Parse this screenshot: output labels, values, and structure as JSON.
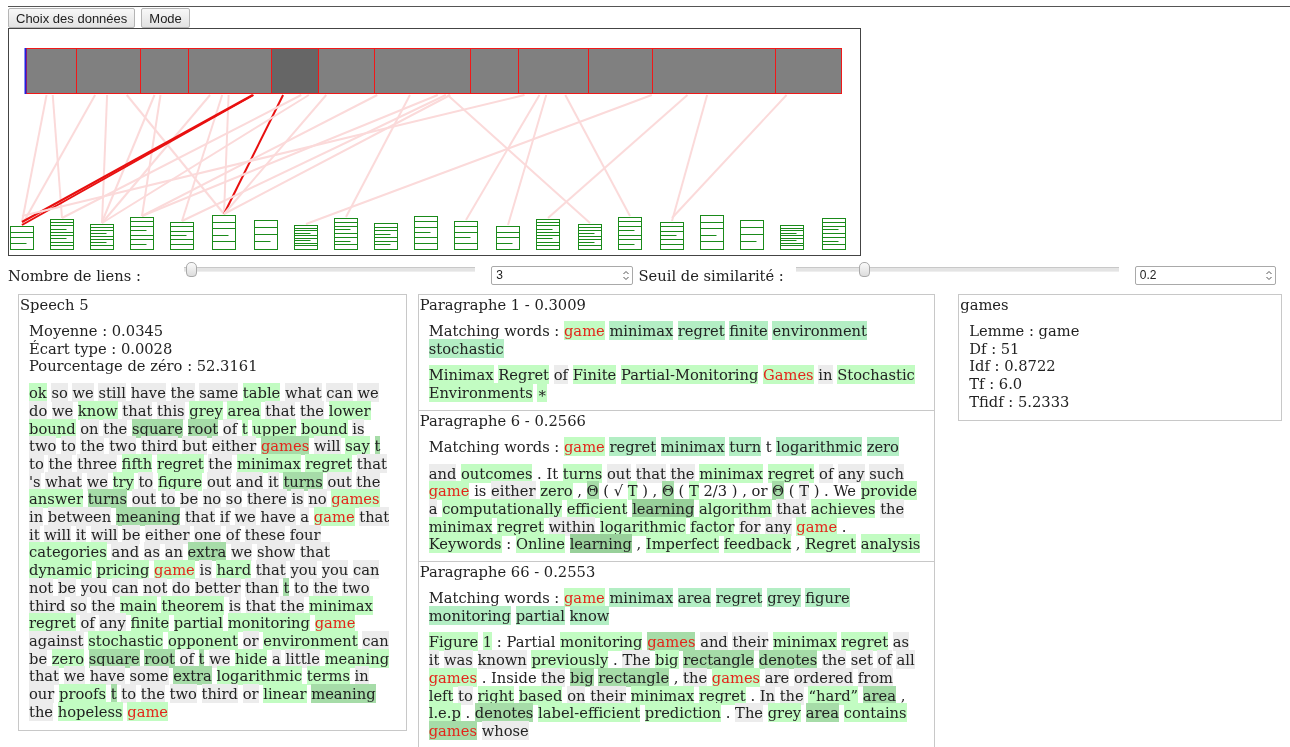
{
  "toolbar": {
    "buttons": [
      "Choix des données",
      "Mode"
    ]
  },
  "graph": {
    "segments": [
      {
        "selected": false
      },
      {
        "selected": false
      },
      {
        "selected": false
      },
      {
        "selected": false
      },
      {
        "selected": true
      },
      {
        "selected": false
      },
      {
        "selected": false
      },
      {
        "selected": false
      },
      {
        "selected": false
      },
      {
        "selected": false
      },
      {
        "selected": false
      },
      {
        "selected": false
      }
    ]
  },
  "controls": [
    {
      "label": "Nombre de liens :",
      "level": 0.02,
      "value": "3"
    },
    {
      "label": "Seuil de similarité :",
      "level": 0.21,
      "value": "0.2"
    }
  ],
  "speech": {
    "title": "Speech 5",
    "stats": [
      "Moyenne : 0.0345",
      "Écart type : 0.0028",
      "Pourcentage de zéro : 52.3161"
    ],
    "tokens": [
      {
        "text": "ok",
        "kind": "light"
      },
      {
        "text": "so",
        "kind": "plain"
      },
      {
        "text": "we",
        "kind": "plain"
      },
      {
        "text": "still",
        "kind": "plain"
      },
      {
        "text": "have",
        "kind": "plain"
      },
      {
        "text": "the",
        "kind": "plain"
      },
      {
        "text": "same",
        "kind": "plain"
      },
      {
        "text": "table",
        "kind": "light"
      },
      {
        "text": "what",
        "kind": "plain"
      },
      {
        "text": "can",
        "kind": "plain"
      },
      {
        "text": "we",
        "kind": "plain"
      },
      {
        "text": "do",
        "kind": "plain"
      },
      {
        "text": "we",
        "kind": "plain"
      },
      {
        "text": "know",
        "kind": "light"
      },
      {
        "text": "that",
        "kind": "plain"
      },
      {
        "text": "this",
        "kind": "plain"
      },
      {
        "text": "grey",
        "kind": "light"
      },
      {
        "text": "area",
        "kind": "light"
      },
      {
        "text": "that",
        "kind": "plain"
      },
      {
        "text": "the",
        "kind": "plain"
      },
      {
        "text": "lower",
        "kind": "light"
      },
      {
        "text": "bound",
        "kind": "light"
      },
      {
        "text": "on",
        "kind": "plain"
      },
      {
        "text": "the",
        "kind": "plain"
      },
      {
        "text": "square",
        "kind": "mid"
      },
      {
        "text": "root",
        "kind": "mid"
      },
      {
        "text": "of",
        "kind": "plain"
      },
      {
        "text": "t",
        "kind": "light"
      },
      {
        "text": "upper",
        "kind": "light"
      },
      {
        "text": "bound",
        "kind": "light"
      },
      {
        "text": "is",
        "kind": "plain"
      },
      {
        "text": "two",
        "kind": "plain"
      },
      {
        "text": "to",
        "kind": "plain"
      },
      {
        "text": "the",
        "kind": "plain"
      },
      {
        "text": "two",
        "kind": "plain"
      },
      {
        "text": "third",
        "kind": "plain"
      },
      {
        "text": "but",
        "kind": "plain"
      },
      {
        "text": "either",
        "kind": "plain"
      },
      {
        "text": "games",
        "kind": "match-dark"
      },
      {
        "text": "will",
        "kind": "plain"
      },
      {
        "text": "say",
        "kind": "light"
      },
      {
        "text": "t",
        "kind": "mid"
      },
      {
        "text": "to",
        "kind": "plain"
      },
      {
        "text": "the",
        "kind": "plain"
      },
      {
        "text": "three",
        "kind": "plain"
      },
      {
        "text": "fifth",
        "kind": "light"
      },
      {
        "text": "regret",
        "kind": "light"
      },
      {
        "text": "the",
        "kind": "plain"
      },
      {
        "text": "minimax",
        "kind": "light"
      },
      {
        "text": "regret",
        "kind": "light"
      },
      {
        "text": "that",
        "kind": "plain"
      },
      {
        "text": "'s",
        "kind": "plain"
      },
      {
        "text": "what",
        "kind": "plain"
      },
      {
        "text": "we",
        "kind": "plain"
      },
      {
        "text": "try",
        "kind": "light"
      },
      {
        "text": "to",
        "kind": "plain"
      },
      {
        "text": "figure",
        "kind": "light"
      },
      {
        "text": "out",
        "kind": "plain"
      },
      {
        "text": "and",
        "kind": "plain"
      },
      {
        "text": "it",
        "kind": "plain"
      },
      {
        "text": "turns",
        "kind": "mid"
      },
      {
        "text": "out",
        "kind": "plain"
      },
      {
        "text": "the",
        "kind": "plain"
      },
      {
        "text": "answer",
        "kind": "light"
      },
      {
        "text": "turns",
        "kind": "mid"
      },
      {
        "text": "out",
        "kind": "plain"
      },
      {
        "text": "to",
        "kind": "plain"
      },
      {
        "text": "be",
        "kind": "plain"
      },
      {
        "text": "no",
        "kind": "plain"
      },
      {
        "text": "so",
        "kind": "plain"
      },
      {
        "text": "there",
        "kind": "plain"
      },
      {
        "text": "is",
        "kind": "plain"
      },
      {
        "text": "no",
        "kind": "plain"
      },
      {
        "text": "games",
        "kind": "match"
      },
      {
        "text": "in",
        "kind": "plain"
      },
      {
        "text": "between",
        "kind": "plain"
      },
      {
        "text": "meaning",
        "kind": "mid"
      },
      {
        "text": "that",
        "kind": "plain"
      },
      {
        "text": "if",
        "kind": "plain"
      },
      {
        "text": "we",
        "kind": "plain"
      },
      {
        "text": "have",
        "kind": "plain"
      },
      {
        "text": "a",
        "kind": "plain"
      },
      {
        "text": "game",
        "kind": "match"
      },
      {
        "text": "that",
        "kind": "plain"
      },
      {
        "text": "it",
        "kind": "plain"
      },
      {
        "text": "will",
        "kind": "plain"
      },
      {
        "text": "it",
        "kind": "plain"
      },
      {
        "text": "will",
        "kind": "plain"
      },
      {
        "text": "be",
        "kind": "plain"
      },
      {
        "text": "either",
        "kind": "plain"
      },
      {
        "text": "one",
        "kind": "plain"
      },
      {
        "text": "of",
        "kind": "plain"
      },
      {
        "text": "these",
        "kind": "plain"
      },
      {
        "text": "four",
        "kind": "plain"
      },
      {
        "text": "categories",
        "kind": "light"
      },
      {
        "text": "and",
        "kind": "plain"
      },
      {
        "text": "as",
        "kind": "plain"
      },
      {
        "text": "an",
        "kind": "plain"
      },
      {
        "text": "extra",
        "kind": "mid"
      },
      {
        "text": "we",
        "kind": "plain"
      },
      {
        "text": "show",
        "kind": "plain"
      },
      {
        "text": "that",
        "kind": "plain"
      },
      {
        "text": "dynamic",
        "kind": "light"
      },
      {
        "text": "pricing",
        "kind": "light"
      },
      {
        "text": "game",
        "kind": "match"
      },
      {
        "text": "is",
        "kind": "plain"
      },
      {
        "text": "hard",
        "kind": "light"
      },
      {
        "text": "that",
        "kind": "plain"
      },
      {
        "text": "you",
        "kind": "plain"
      },
      {
        "text": "you",
        "kind": "plain"
      },
      {
        "text": "can",
        "kind": "plain"
      },
      {
        "text": "not",
        "kind": "plain"
      },
      {
        "text": "be",
        "kind": "plain"
      },
      {
        "text": "you",
        "kind": "plain"
      },
      {
        "text": "can",
        "kind": "plain"
      },
      {
        "text": "not",
        "kind": "plain"
      },
      {
        "text": "do",
        "kind": "plain"
      },
      {
        "text": "better",
        "kind": "plain"
      },
      {
        "text": "than",
        "kind": "plain"
      },
      {
        "text": "t",
        "kind": "mid"
      },
      {
        "text": "to",
        "kind": "plain"
      },
      {
        "text": "the",
        "kind": "plain"
      },
      {
        "text": "two",
        "kind": "plain"
      },
      {
        "text": "third",
        "kind": "plain"
      },
      {
        "text": "so",
        "kind": "plain"
      },
      {
        "text": "the",
        "kind": "plain"
      },
      {
        "text": "main",
        "kind": "light"
      },
      {
        "text": "theorem",
        "kind": "light"
      },
      {
        "text": "is",
        "kind": "plain"
      },
      {
        "text": "that",
        "kind": "plain"
      },
      {
        "text": "the",
        "kind": "plain"
      },
      {
        "text": "minimax",
        "kind": "light"
      },
      {
        "text": "regret",
        "kind": "light"
      },
      {
        "text": "of",
        "kind": "plain"
      },
      {
        "text": "any",
        "kind": "plain"
      },
      {
        "text": "finite",
        "kind": "light"
      },
      {
        "text": "partial",
        "kind": "light"
      },
      {
        "text": "monitoring",
        "kind": "light"
      },
      {
        "text": "game",
        "kind": "match"
      },
      {
        "text": "against",
        "kind": "plain"
      },
      {
        "text": "stochastic",
        "kind": "light"
      },
      {
        "text": "opponent",
        "kind": "light"
      },
      {
        "text": "or",
        "kind": "plain"
      },
      {
        "text": "environment",
        "kind": "light"
      },
      {
        "text": "can",
        "kind": "plain"
      },
      {
        "text": "be",
        "kind": "plain"
      },
      {
        "text": "zero",
        "kind": "light"
      },
      {
        "text": "square",
        "kind": "mid"
      },
      {
        "text": "root",
        "kind": "mid"
      },
      {
        "text": "of",
        "kind": "plain"
      },
      {
        "text": "t",
        "kind": "mid"
      },
      {
        "text": "we",
        "kind": "plain"
      },
      {
        "text": "hide",
        "kind": "light"
      },
      {
        "text": "a",
        "kind": "plain"
      },
      {
        "text": "little",
        "kind": "plain"
      },
      {
        "text": "meaning",
        "kind": "light"
      },
      {
        "text": "that",
        "kind": "plain"
      },
      {
        "text": "we",
        "kind": "plain"
      },
      {
        "text": "have",
        "kind": "plain"
      },
      {
        "text": "some",
        "kind": "plain"
      },
      {
        "text": "extra",
        "kind": "mid"
      },
      {
        "text": "logarithmic",
        "kind": "light"
      },
      {
        "text": "terms",
        "kind": "light"
      },
      {
        "text": "in",
        "kind": "plain"
      },
      {
        "text": "our",
        "kind": "plain"
      },
      {
        "text": "proofs",
        "kind": "light"
      },
      {
        "text": "t",
        "kind": "mid"
      },
      {
        "text": "to",
        "kind": "plain"
      },
      {
        "text": "the",
        "kind": "plain"
      },
      {
        "text": "two",
        "kind": "plain"
      },
      {
        "text": "third",
        "kind": "plain"
      },
      {
        "text": "or",
        "kind": "plain"
      },
      {
        "text": "linear",
        "kind": "light"
      },
      {
        "text": "meaning",
        "kind": "mid"
      },
      {
        "text": "the",
        "kind": "plain"
      },
      {
        "text": "hopeless",
        "kind": "light"
      },
      {
        "text": "game",
        "kind": "match"
      }
    ]
  },
  "paragraphs": [
    {
      "title": "Paragraphe 1 - 0.3009",
      "matching_label": "Matching words :",
      "matching_words": [
        {
          "text": "game",
          "kind": "match"
        },
        {
          "text": "minimax",
          "kind": "keyword"
        },
        {
          "text": "regret",
          "kind": "keyword"
        },
        {
          "text": "finite",
          "kind": "keyword"
        },
        {
          "text": "environment",
          "kind": "keyword"
        },
        {
          "text": "stochastic",
          "kind": "keyword"
        }
      ],
      "tokens": [
        {
          "text": "Minimax",
          "kind": "light"
        },
        {
          "text": "Regret",
          "kind": "light"
        },
        {
          "text": "of",
          "kind": "plain"
        },
        {
          "text": "Finite",
          "kind": "light"
        },
        {
          "text": "Partial-Monitoring",
          "kind": "light"
        },
        {
          "text": "Games",
          "kind": "match"
        },
        {
          "text": "in",
          "kind": "plain"
        },
        {
          "text": "Stochastic",
          "kind": "light"
        },
        {
          "text": "Environments",
          "kind": "light"
        },
        {
          "text": "∗",
          "kind": "light"
        }
      ]
    },
    {
      "title": "Paragraphe 6 - 0.2566",
      "matching_label": "Matching words :",
      "matching_words": [
        {
          "text": "game",
          "kind": "match"
        },
        {
          "text": "regret",
          "kind": "keyword"
        },
        {
          "text": "minimax",
          "kind": "keyword"
        },
        {
          "text": "turn",
          "kind": "keyword"
        },
        {
          "text": "t",
          "kind": "none"
        },
        {
          "text": "logarithmic",
          "kind": "keyword"
        },
        {
          "text": "zero",
          "kind": "keyword"
        }
      ],
      "tokens": [
        {
          "text": "and",
          "kind": "plain"
        },
        {
          "text": "outcomes",
          "kind": "light"
        },
        {
          "text": ".",
          "kind": "none"
        },
        {
          "text": "It",
          "kind": "none"
        },
        {
          "text": "turns",
          "kind": "light"
        },
        {
          "text": "out",
          "kind": "plain"
        },
        {
          "text": "that",
          "kind": "plain"
        },
        {
          "text": "the",
          "kind": "plain"
        },
        {
          "text": "minimax",
          "kind": "light"
        },
        {
          "text": "regret",
          "kind": "light"
        },
        {
          "text": "of",
          "kind": "plain"
        },
        {
          "text": "any",
          "kind": "plain"
        },
        {
          "text": "such",
          "kind": "plain"
        },
        {
          "text": "game",
          "kind": "match"
        },
        {
          "text": "is",
          "kind": "none"
        },
        {
          "text": "either",
          "kind": "plain"
        },
        {
          "text": "zero",
          "kind": "light"
        },
        {
          "text": ",",
          "kind": "none"
        },
        {
          "text": "Θ",
          "kind": "mid"
        },
        {
          "text": "(",
          "kind": "none"
        },
        {
          "text": "√",
          "kind": "none"
        },
        {
          "text": "T",
          "kind": "light"
        },
        {
          "text": ")",
          "kind": "none"
        },
        {
          "text": ",",
          "kind": "none"
        },
        {
          "text": "Θ",
          "kind": "mid"
        },
        {
          "text": "(",
          "kind": "none"
        },
        {
          "text": "T",
          "kind": "light"
        },
        {
          "text": "2/3",
          "kind": "none"
        },
        {
          "text": ")",
          "kind": "none"
        },
        {
          "text": ",",
          "kind": "none"
        },
        {
          "text": "or",
          "kind": "none"
        },
        {
          "text": "Θ",
          "kind": "mid"
        },
        {
          "text": "(",
          "kind": "none"
        },
        {
          "text": "T",
          "kind": "plain"
        },
        {
          "text": ")",
          "kind": "none"
        },
        {
          "text": ".",
          "kind": "none"
        },
        {
          "text": "We",
          "kind": "none"
        },
        {
          "text": "provide",
          "kind": "light"
        },
        {
          "text": "a",
          "kind": "plain"
        },
        {
          "text": "computationally",
          "kind": "light"
        },
        {
          "text": "efficient",
          "kind": "light"
        },
        {
          "text": "learning",
          "kind": "dark"
        },
        {
          "text": "algorithm",
          "kind": "light"
        },
        {
          "text": "that",
          "kind": "plain"
        },
        {
          "text": "achieves",
          "kind": "light"
        },
        {
          "text": "the",
          "kind": "plain"
        },
        {
          "text": "minimax",
          "kind": "light"
        },
        {
          "text": "regret",
          "kind": "light"
        },
        {
          "text": "within",
          "kind": "plain"
        },
        {
          "text": "logarithmic",
          "kind": "light"
        },
        {
          "text": "factor",
          "kind": "light"
        },
        {
          "text": "for",
          "kind": "plain"
        },
        {
          "text": "any",
          "kind": "plain"
        },
        {
          "text": "game",
          "kind": "match"
        },
        {
          "text": ".",
          "kind": "none"
        },
        {
          "text": "Keywords",
          "kind": "light"
        },
        {
          "text": ":",
          "kind": "none"
        },
        {
          "text": "Online",
          "kind": "light"
        },
        {
          "text": "learning",
          "kind": "dark"
        },
        {
          "text": ",",
          "kind": "none"
        },
        {
          "text": "Imperfect",
          "kind": "light"
        },
        {
          "text": "feedback",
          "kind": "light"
        },
        {
          "text": ",",
          "kind": "none"
        },
        {
          "text": "Regret",
          "kind": "light"
        },
        {
          "text": "analysis",
          "kind": "light"
        }
      ]
    },
    {
      "title": "Paragraphe 66 - 0.2553",
      "matching_label": "Matching words :",
      "matching_words": [
        {
          "text": "game",
          "kind": "match"
        },
        {
          "text": "minimax",
          "kind": "keyword"
        },
        {
          "text": "area",
          "kind": "keyword"
        },
        {
          "text": "regret",
          "kind": "keyword"
        },
        {
          "text": "grey",
          "kind": "keyword"
        },
        {
          "text": "figure",
          "kind": "keyword"
        },
        {
          "text": "monitoring",
          "kind": "keyword"
        },
        {
          "text": "partial",
          "kind": "keyword"
        },
        {
          "text": "know",
          "kind": "keyword"
        }
      ],
      "tokens": [
        {
          "text": "Figure",
          "kind": "light"
        },
        {
          "text": "1",
          "kind": "light"
        },
        {
          "text": ":",
          "kind": "none"
        },
        {
          "text": "Partial",
          "kind": "none"
        },
        {
          "text": "monitoring",
          "kind": "light"
        },
        {
          "text": "games",
          "kind": "match-dark"
        },
        {
          "text": "and",
          "kind": "plain"
        },
        {
          "text": "their",
          "kind": "plain"
        },
        {
          "text": "minimax",
          "kind": "light"
        },
        {
          "text": "regret",
          "kind": "light"
        },
        {
          "text": "as",
          "kind": "plain"
        },
        {
          "text": "it",
          "kind": "plain"
        },
        {
          "text": "was",
          "kind": "plain"
        },
        {
          "text": "known",
          "kind": "plain"
        },
        {
          "text": "previously",
          "kind": "light"
        },
        {
          "text": ".",
          "kind": "none"
        },
        {
          "text": "The",
          "kind": "plain"
        },
        {
          "text": "big",
          "kind": "light"
        },
        {
          "text": "rectangle",
          "kind": "mid"
        },
        {
          "text": "denotes",
          "kind": "mid"
        },
        {
          "text": "the",
          "kind": "plain"
        },
        {
          "text": "set",
          "kind": "plain"
        },
        {
          "text": "of",
          "kind": "plain"
        },
        {
          "text": "all",
          "kind": "plain"
        },
        {
          "text": "games",
          "kind": "match"
        },
        {
          "text": ".",
          "kind": "none"
        },
        {
          "text": "Inside",
          "kind": "none"
        },
        {
          "text": "the",
          "kind": "plain"
        },
        {
          "text": "big",
          "kind": "mid"
        },
        {
          "text": "rectangle",
          "kind": "mid"
        },
        {
          "text": ",",
          "kind": "none"
        },
        {
          "text": "the",
          "kind": "plain"
        },
        {
          "text": "games",
          "kind": "match"
        },
        {
          "text": "are",
          "kind": "plain"
        },
        {
          "text": "ordered",
          "kind": "plain"
        },
        {
          "text": "from",
          "kind": "plain"
        },
        {
          "text": "left",
          "kind": "light"
        },
        {
          "text": "to",
          "kind": "plain"
        },
        {
          "text": "right",
          "kind": "light"
        },
        {
          "text": "based",
          "kind": "light"
        },
        {
          "text": "on",
          "kind": "plain"
        },
        {
          "text": "their",
          "kind": "plain"
        },
        {
          "text": "minimax",
          "kind": "light"
        },
        {
          "text": "regret",
          "kind": "light"
        },
        {
          "text": ".",
          "kind": "none"
        },
        {
          "text": "In",
          "kind": "plain"
        },
        {
          "text": "the",
          "kind": "plain"
        },
        {
          "text": "“hard”",
          "kind": "light"
        },
        {
          "text": "area",
          "kind": "mid"
        },
        {
          "text": ",",
          "kind": "none"
        },
        {
          "text": "l.e.p",
          "kind": "light"
        },
        {
          "text": ".",
          "kind": "none"
        },
        {
          "text": "denotes",
          "kind": "mid"
        },
        {
          "text": "label-efficient",
          "kind": "light"
        },
        {
          "text": "prediction",
          "kind": "light"
        },
        {
          "text": ".",
          "kind": "none"
        },
        {
          "text": "The",
          "kind": "plain"
        },
        {
          "text": "grey",
          "kind": "light"
        },
        {
          "text": "area",
          "kind": "mid"
        },
        {
          "text": "contains",
          "kind": "light"
        },
        {
          "text": "games",
          "kind": "match-dark"
        },
        {
          "text": "whose",
          "kind": "plain"
        }
      ]
    }
  ],
  "word_info": {
    "title": "games",
    "lines": [
      "Lemme : game",
      "Df : 51",
      "Idf : 0.8722",
      "Tf : 6.0",
      "Tfidf : 5.2333"
    ]
  }
}
